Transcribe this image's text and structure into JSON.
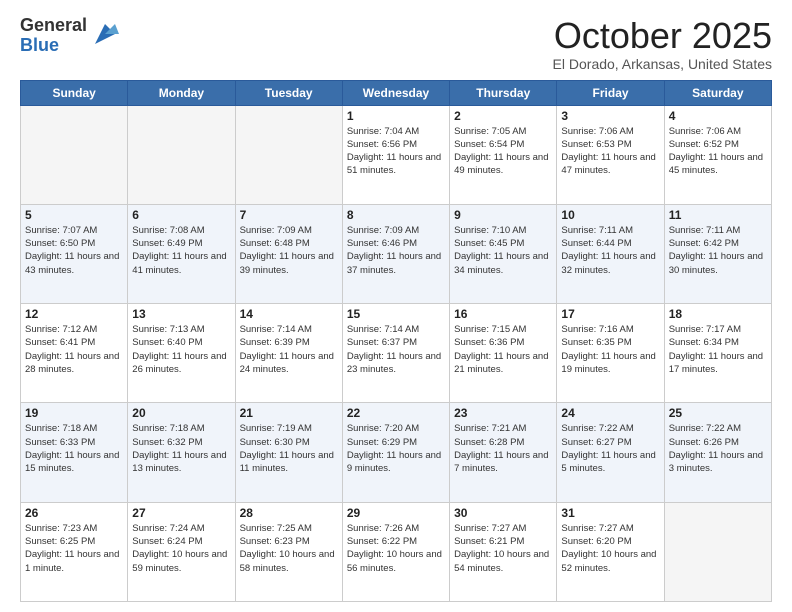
{
  "logo": {
    "general": "General",
    "blue": "Blue"
  },
  "header": {
    "month": "October 2025",
    "location": "El Dorado, Arkansas, United States"
  },
  "days_of_week": [
    "Sunday",
    "Monday",
    "Tuesday",
    "Wednesday",
    "Thursday",
    "Friday",
    "Saturday"
  ],
  "weeks": [
    [
      {
        "day": "",
        "empty": true
      },
      {
        "day": "",
        "empty": true
      },
      {
        "day": "",
        "empty": true
      },
      {
        "day": "1",
        "sunrise": "7:04 AM",
        "sunset": "6:56 PM",
        "daylight": "11 hours and 51 minutes."
      },
      {
        "day": "2",
        "sunrise": "7:05 AM",
        "sunset": "6:54 PM",
        "daylight": "11 hours and 49 minutes."
      },
      {
        "day": "3",
        "sunrise": "7:06 AM",
        "sunset": "6:53 PM",
        "daylight": "11 hours and 47 minutes."
      },
      {
        "day": "4",
        "sunrise": "7:06 AM",
        "sunset": "6:52 PM",
        "daylight": "11 hours and 45 minutes."
      }
    ],
    [
      {
        "day": "5",
        "sunrise": "7:07 AM",
        "sunset": "6:50 PM",
        "daylight": "11 hours and 43 minutes."
      },
      {
        "day": "6",
        "sunrise": "7:08 AM",
        "sunset": "6:49 PM",
        "daylight": "11 hours and 41 minutes."
      },
      {
        "day": "7",
        "sunrise": "7:09 AM",
        "sunset": "6:48 PM",
        "daylight": "11 hours and 39 minutes."
      },
      {
        "day": "8",
        "sunrise": "7:09 AM",
        "sunset": "6:46 PM",
        "daylight": "11 hours and 37 minutes."
      },
      {
        "day": "9",
        "sunrise": "7:10 AM",
        "sunset": "6:45 PM",
        "daylight": "11 hours and 34 minutes."
      },
      {
        "day": "10",
        "sunrise": "7:11 AM",
        "sunset": "6:44 PM",
        "daylight": "11 hours and 32 minutes."
      },
      {
        "day": "11",
        "sunrise": "7:11 AM",
        "sunset": "6:42 PM",
        "daylight": "11 hours and 30 minutes."
      }
    ],
    [
      {
        "day": "12",
        "sunrise": "7:12 AM",
        "sunset": "6:41 PM",
        "daylight": "11 hours and 28 minutes."
      },
      {
        "day": "13",
        "sunrise": "7:13 AM",
        "sunset": "6:40 PM",
        "daylight": "11 hours and 26 minutes."
      },
      {
        "day": "14",
        "sunrise": "7:14 AM",
        "sunset": "6:39 PM",
        "daylight": "11 hours and 24 minutes."
      },
      {
        "day": "15",
        "sunrise": "7:14 AM",
        "sunset": "6:37 PM",
        "daylight": "11 hours and 23 minutes."
      },
      {
        "day": "16",
        "sunrise": "7:15 AM",
        "sunset": "6:36 PM",
        "daylight": "11 hours and 21 minutes."
      },
      {
        "day": "17",
        "sunrise": "7:16 AM",
        "sunset": "6:35 PM",
        "daylight": "11 hours and 19 minutes."
      },
      {
        "day": "18",
        "sunrise": "7:17 AM",
        "sunset": "6:34 PM",
        "daylight": "11 hours and 17 minutes."
      }
    ],
    [
      {
        "day": "19",
        "sunrise": "7:18 AM",
        "sunset": "6:33 PM",
        "daylight": "11 hours and 15 minutes."
      },
      {
        "day": "20",
        "sunrise": "7:18 AM",
        "sunset": "6:32 PM",
        "daylight": "11 hours and 13 minutes."
      },
      {
        "day": "21",
        "sunrise": "7:19 AM",
        "sunset": "6:30 PM",
        "daylight": "11 hours and 11 minutes."
      },
      {
        "day": "22",
        "sunrise": "7:20 AM",
        "sunset": "6:29 PM",
        "daylight": "11 hours and 9 minutes."
      },
      {
        "day": "23",
        "sunrise": "7:21 AM",
        "sunset": "6:28 PM",
        "daylight": "11 hours and 7 minutes."
      },
      {
        "day": "24",
        "sunrise": "7:22 AM",
        "sunset": "6:27 PM",
        "daylight": "11 hours and 5 minutes."
      },
      {
        "day": "25",
        "sunrise": "7:22 AM",
        "sunset": "6:26 PM",
        "daylight": "11 hours and 3 minutes."
      }
    ],
    [
      {
        "day": "26",
        "sunrise": "7:23 AM",
        "sunset": "6:25 PM",
        "daylight": "11 hours and 1 minute."
      },
      {
        "day": "27",
        "sunrise": "7:24 AM",
        "sunset": "6:24 PM",
        "daylight": "10 hours and 59 minutes."
      },
      {
        "day": "28",
        "sunrise": "7:25 AM",
        "sunset": "6:23 PM",
        "daylight": "10 hours and 58 minutes."
      },
      {
        "day": "29",
        "sunrise": "7:26 AM",
        "sunset": "6:22 PM",
        "daylight": "10 hours and 56 minutes."
      },
      {
        "day": "30",
        "sunrise": "7:27 AM",
        "sunset": "6:21 PM",
        "daylight": "10 hours and 54 minutes."
      },
      {
        "day": "31",
        "sunrise": "7:27 AM",
        "sunset": "6:20 PM",
        "daylight": "10 hours and 52 minutes."
      },
      {
        "day": "",
        "empty": true
      }
    ]
  ]
}
